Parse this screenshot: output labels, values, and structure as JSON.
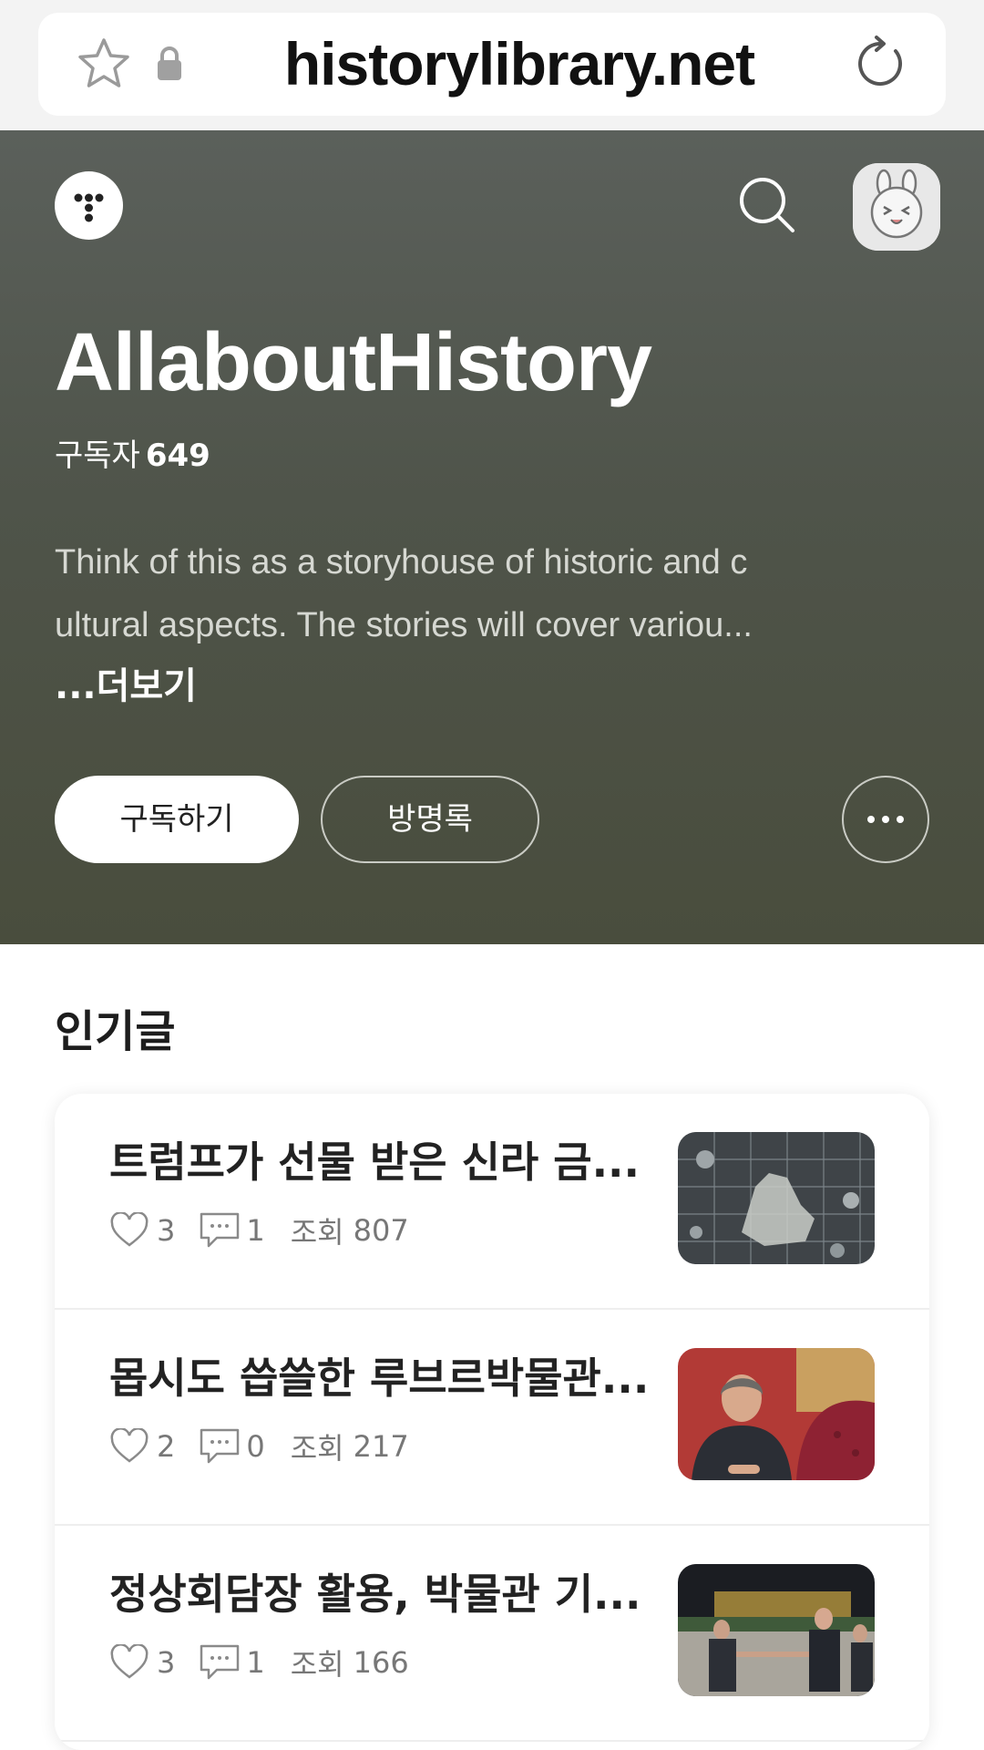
{
  "browser": {
    "url": "historylibrary.net"
  },
  "blog": {
    "title": "AllaboutHistory",
    "subscribers_label": "구독자",
    "subscribers_count": "649",
    "description_lines": [
      "Think of this as a storyhouse of historic and c",
      "ultural aspects. The stories will cover variou..."
    ],
    "more_label": "...더보기",
    "subscribe_button": "구독하기",
    "guestbook_button": "방명록"
  },
  "popular": {
    "section_title": "인기글",
    "views_label": "조회",
    "posts": [
      {
        "title": "트럼프가 선물 받은 신라 금...",
        "likes": "3",
        "comments": "1",
        "views": "807",
        "thumb_icon": "gold-crown-fragments-image"
      },
      {
        "title": "몹시도 씁쓸한 루브르박물관...",
        "likes": "2",
        "comments": "0",
        "views": "217",
        "thumb_icon": "woman-portrait-image"
      },
      {
        "title": "정상회담장 활용, 박물관 기...",
        "likes": "3",
        "comments": "1",
        "views": "166",
        "thumb_icon": "summit-handshake-image"
      }
    ]
  },
  "colors": {
    "hero_top": "#5b605b",
    "hero_bottom": "#494d3d",
    "accent_white": "#ffffff"
  }
}
